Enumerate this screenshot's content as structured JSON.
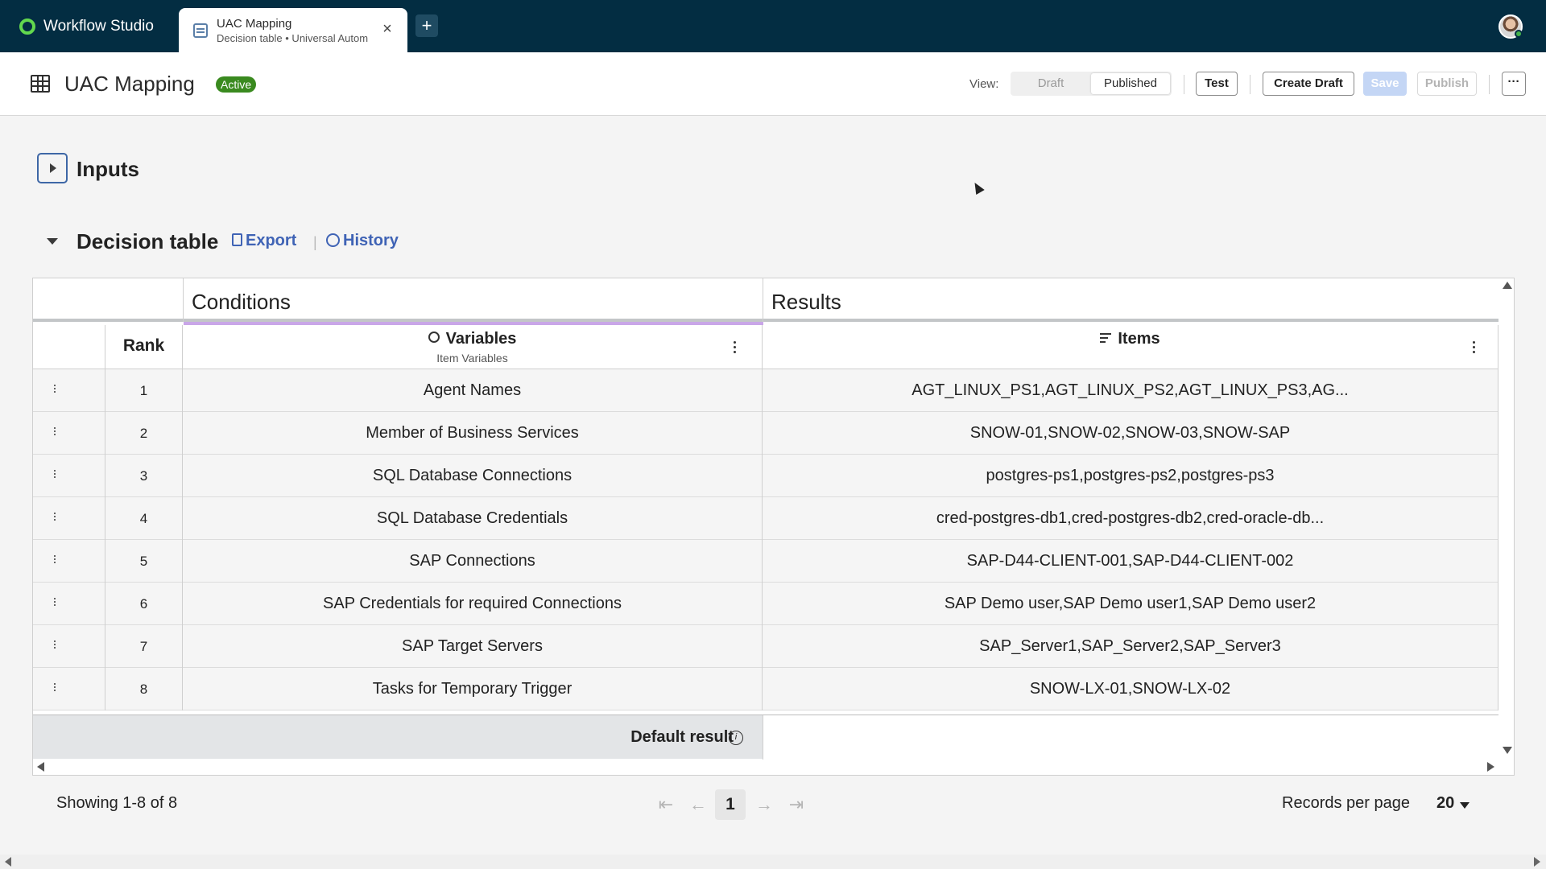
{
  "app": {
    "name": "Workflow Studio"
  },
  "tab": {
    "title": "UAC Mapping",
    "subtitle": "Decision table • Universal Autom",
    "close_icon": "close-icon",
    "new_tab_label": "+"
  },
  "header": {
    "title": "UAC Mapping",
    "status": "Active",
    "view_label": "View:",
    "view_options": [
      "Draft",
      "Published"
    ],
    "view_selected": "Published",
    "test_label": "Test",
    "create_draft_label": "Create Draft",
    "save_label": "Save",
    "publish_label": "Publish",
    "more_label": "···"
  },
  "inputs": {
    "title": "Inputs"
  },
  "decision_table": {
    "title": "Decision table",
    "export_label": "Export",
    "history_label": "History",
    "groups": {
      "conditions": "Conditions",
      "results": "Results"
    },
    "columns": {
      "rank": "Rank",
      "variables": {
        "title": "Variables",
        "subtitle": "Item Variables"
      },
      "items": {
        "title": "Items"
      }
    },
    "rows": [
      {
        "rank": "1",
        "variable": "Agent Names",
        "items": "AGT_LINUX_PS1,AGT_LINUX_PS2,AGT_LINUX_PS3,AG..."
      },
      {
        "rank": "2",
        "variable": "Member of Business Services",
        "items": "SNOW-01,SNOW-02,SNOW-03,SNOW-SAP"
      },
      {
        "rank": "3",
        "variable": "SQL Database Connections",
        "items": "postgres-ps1,postgres-ps2,postgres-ps3"
      },
      {
        "rank": "4",
        "variable": "SQL Database Credentials",
        "items": "cred-postgres-db1,cred-postgres-db2,cred-oracle-db..."
      },
      {
        "rank": "5",
        "variable": "SAP Connections",
        "items": "SAP-D44-CLIENT-001,SAP-D44-CLIENT-002"
      },
      {
        "rank": "6",
        "variable": "SAP Credentials for required Connections",
        "items": "SAP Demo user,SAP Demo user1,SAP Demo user2"
      },
      {
        "rank": "7",
        "variable": "SAP Target Servers",
        "items": "SAP_Server1,SAP_Server2,SAP_Server3"
      },
      {
        "rank": "8",
        "variable": "Tasks for Temporary Trigger",
        "items": "SNOW-LX-01,SNOW-LX-02"
      }
    ],
    "default_result_label": "Default result"
  },
  "pagination": {
    "showing": "Showing 1-8 of 8",
    "current_page": "1",
    "first": "⇤",
    "prev": "←",
    "next": "→",
    "last": "⇥",
    "records_per_page_label": "Records per page",
    "records_per_page_value": "20"
  },
  "colors": {
    "topbar": "#032d42",
    "brand_accent": "#62d84e",
    "active_badge": "#3a8a1f",
    "link": "#3f63b5",
    "conditions_accent": "#c9a6e8"
  }
}
